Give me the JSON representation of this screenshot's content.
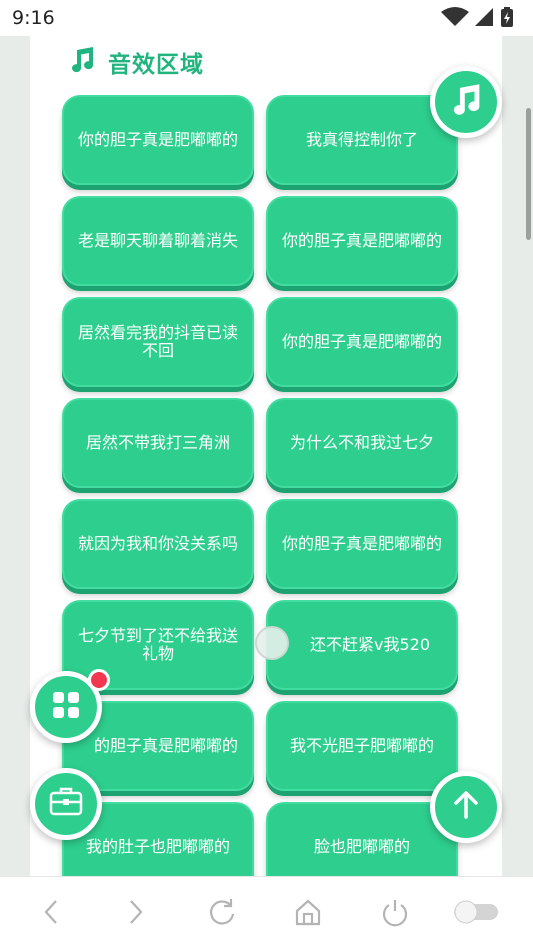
{
  "status_bar": {
    "time": "9:16",
    "icons": [
      "wifi-icon",
      "signal-icon",
      "battery-charging-icon"
    ]
  },
  "section": {
    "title": "音效区域",
    "icon": "music-note-icon"
  },
  "sound_buttons": [
    {
      "label": "你的胆子真是肥嘟嘟的"
    },
    {
      "label": "我真得控制你了"
    },
    {
      "label": "老是聊天聊着聊着消失"
    },
    {
      "label": "你的胆子真是肥嘟嘟的"
    },
    {
      "label": "居然看完我的抖音已读不回"
    },
    {
      "label": "你的胆子真是肥嘟嘟的"
    },
    {
      "label": "居然不带我打三角洲"
    },
    {
      "label": "为什么不和我过七夕"
    },
    {
      "label": "就因为我和你没关系吗"
    },
    {
      "label": "你的胆子真是肥嘟嘟的"
    },
    {
      "label": "七夕节到了还不给我送礼物"
    },
    {
      "label": "还不赶紧v我520"
    },
    {
      "label": "的胆子真是肥嘟嘟的"
    },
    {
      "label": "我不光胆子肥嘟嘟的"
    },
    {
      "label": "我的肚子也肥嘟嘟的"
    },
    {
      "label": "脸也肥嘟嘟的"
    }
  ],
  "fabs": {
    "music": "music-note-icon",
    "grid": "grid-icon",
    "toolbox": "toolbox-icon",
    "scroll_top": "arrow-up-icon"
  },
  "colors": {
    "accent": "#2ecf8e",
    "accent_dark": "#1da272",
    "title": "#22b47e",
    "badge": "#f2384f"
  },
  "nav_bar": [
    "back-icon",
    "forward-icon",
    "refresh-icon",
    "home-icon",
    "power-icon",
    "toggle-icon"
  ]
}
